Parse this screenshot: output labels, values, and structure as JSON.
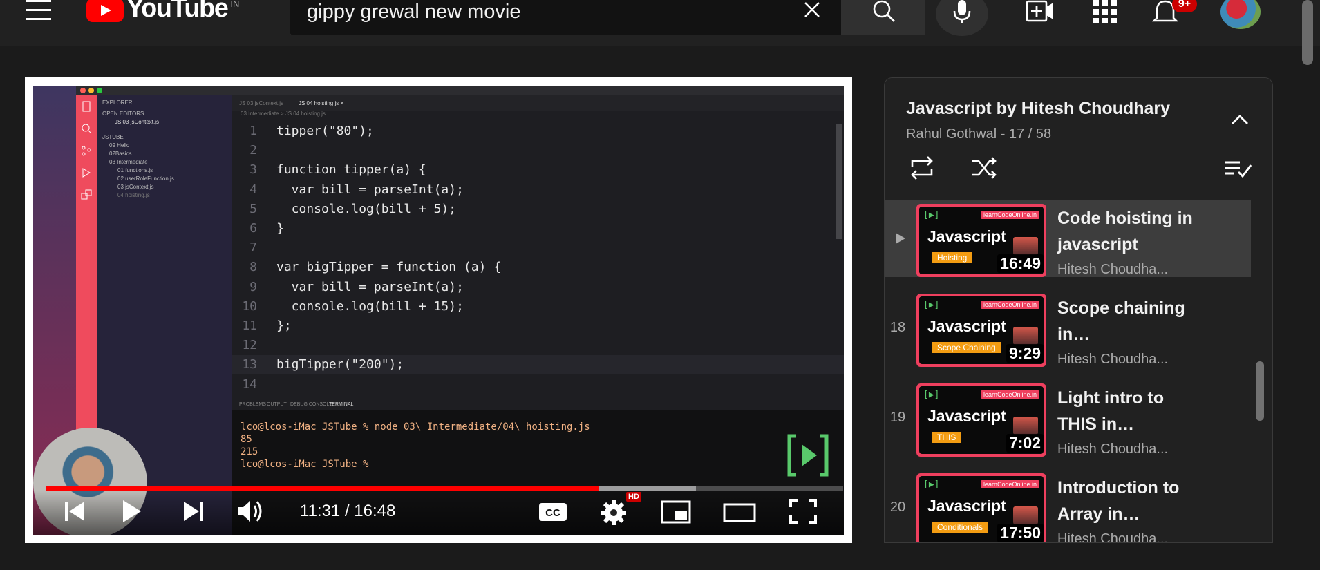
{
  "header": {
    "logo_text": "YouTube",
    "country_code": "IN",
    "search": {
      "value": "gippy grewal new movie",
      "placeholder": "Search"
    },
    "notifications_count": "9+"
  },
  "video": {
    "code_lines": [
      {
        "n": "1",
        "text": "tipper(\"80\");"
      },
      {
        "n": "2",
        "text": ""
      },
      {
        "n": "3",
        "text": "function tipper(a) {"
      },
      {
        "n": "4",
        "text": "  var bill = parseInt(a);"
      },
      {
        "n": "5",
        "text": "  console.log(bill + 5);"
      },
      {
        "n": "6",
        "text": "}"
      },
      {
        "n": "7",
        "text": ""
      },
      {
        "n": "8",
        "text": "var bigTipper = function (a) {"
      },
      {
        "n": "9",
        "text": "  var bill = parseInt(a);"
      },
      {
        "n": "10",
        "text": "  console.log(bill + 15);"
      },
      {
        "n": "11",
        "text": "};"
      },
      {
        "n": "12",
        "text": ""
      },
      {
        "n": "13",
        "text": "bigTipper(\"200\");"
      },
      {
        "n": "14",
        "text": ""
      }
    ],
    "terminal_lines": [
      "lco@lcos-iMac JSTube % node 03\\ Intermediate/04\\ hoisting.js",
      "85",
      "215",
      "lco@lcos-iMac JSTube % "
    ],
    "progress_percent": 69.4,
    "buffer_percent": 81.5
  },
  "player": {
    "time_display": "11:31 / 16:48",
    "hd_badge": "HD"
  },
  "playlist": {
    "title": "Javascript by Hitesh Choudhary",
    "subtitle": "Rahul Gothwal - 17 / 58",
    "items": [
      {
        "index": "",
        "title": "Code hoisting in javascript",
        "channel": "Hitesh Choudha...",
        "duration": "16:49",
        "tag": "Hoisting",
        "active": true
      },
      {
        "index": "18",
        "title": "Scope chaining in…",
        "channel": "Hitesh Choudha...",
        "duration": "9:29",
        "tag": "Scope Chaining",
        "active": false
      },
      {
        "index": "19",
        "title": "Light intro to THIS in…",
        "channel": "Hitesh Choudha...",
        "duration": "7:02",
        "tag": "THIS",
        "active": false
      },
      {
        "index": "20",
        "title": "Introduction to Array in…",
        "channel": "Hitesh Choudha...",
        "duration": "17:50",
        "tag": "Conditionals",
        "active": false
      }
    ]
  },
  "colors": {
    "accent_red": "#ff0000",
    "background": "#1b1b1b",
    "panel": "#212121"
  }
}
